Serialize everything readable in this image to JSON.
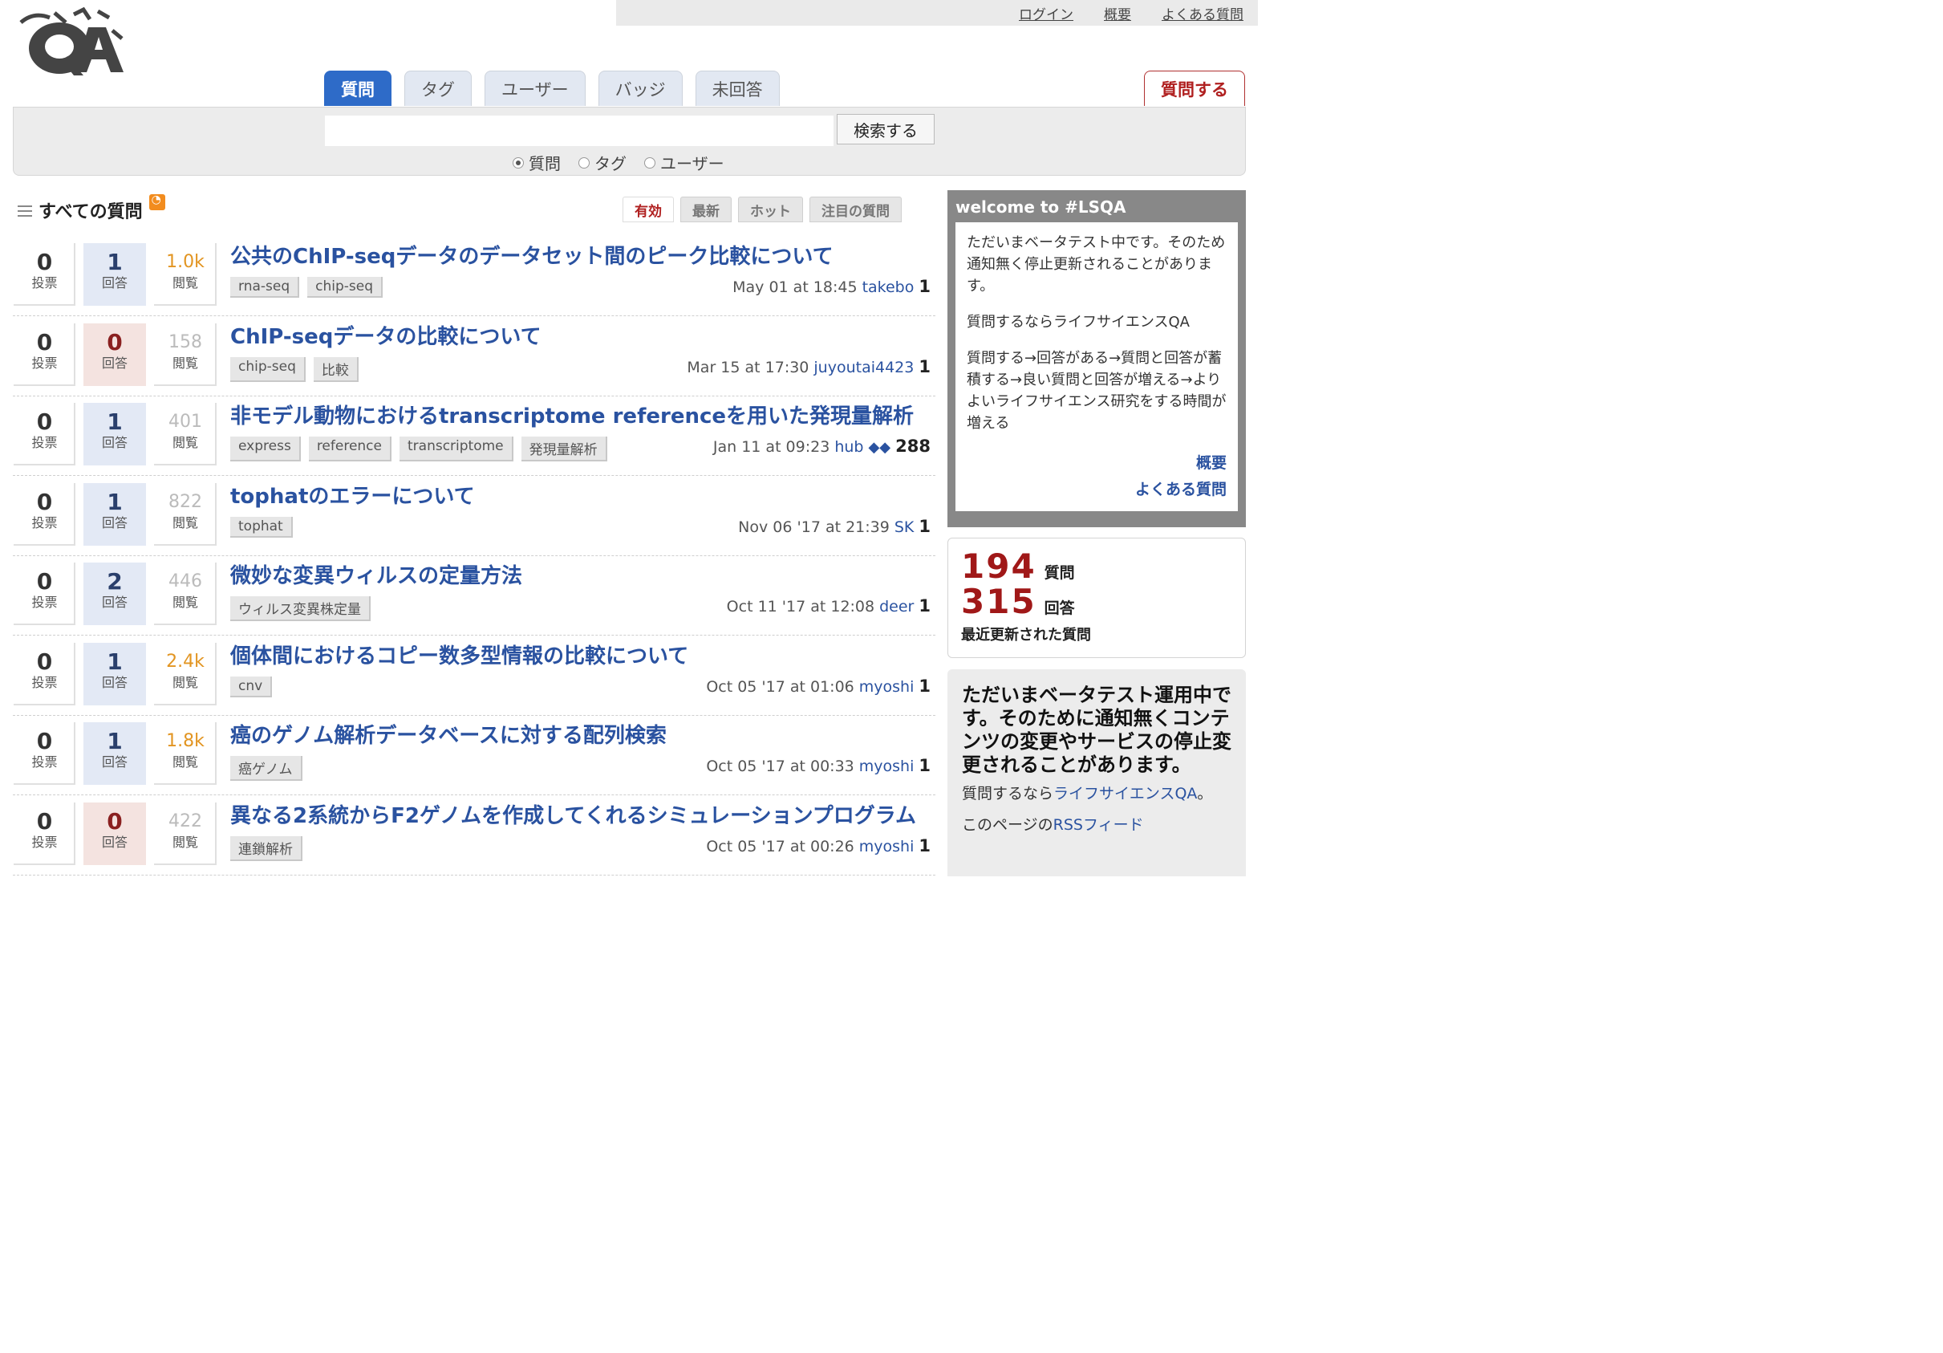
{
  "top_links": [
    "ログイン",
    "概要",
    "よくある質問"
  ],
  "logo_text": "ライフサイエンスQA",
  "tabs": [
    "質問",
    "タグ",
    "ユーザー",
    "バッジ",
    "未回答"
  ],
  "ask_button": "質問する",
  "search": {
    "button": "検索する",
    "value": "",
    "options": [
      "質問",
      "タグ",
      "ユーザー"
    ],
    "selected": "質問"
  },
  "list": {
    "title": "すべての質問",
    "sorts": [
      "有効",
      "最新",
      "ホット",
      "注目の質問"
    ],
    "vote_label": "投票",
    "answer_label": "回答",
    "view_label": "閲覧"
  },
  "questions": [
    {
      "votes": "0",
      "answers": "1",
      "views": "1.0k",
      "title": "公共のChIP-seqデータのデータセット間のピーク比較について",
      "tags": [
        "rna-seq",
        "chip-seq"
      ],
      "time": "May 01 at 18:45",
      "user": "takebo",
      "badges": "",
      "rep": "1"
    },
    {
      "votes": "0",
      "answers": "0",
      "views": "158",
      "title": "ChIP-seqデータの比較について",
      "tags": [
        "chip-seq",
        "比較"
      ],
      "time": "Mar 15 at 17:30",
      "user": "juyoutai4423",
      "badges": "",
      "rep": "1"
    },
    {
      "votes": "0",
      "answers": "1",
      "views": "401",
      "title": "非モデル動物におけるtranscriptome referenceを用いた発現量解析",
      "tags": [
        "express",
        "reference",
        "transcriptome",
        "発現量解析"
      ],
      "time": "Jan 11 at 09:23",
      "user": "hub",
      "badges": "◆◆",
      "rep": "288"
    },
    {
      "votes": "0",
      "answers": "1",
      "views": "822",
      "title": "tophatのエラーについて",
      "tags": [
        "tophat"
      ],
      "time": "Nov 06 '17 at 21:39",
      "user": "SK",
      "badges": "",
      "rep": "1"
    },
    {
      "votes": "0",
      "answers": "2",
      "views": "446",
      "title": "微妙な変異ウィルスの定量方法",
      "tags": [
        "ウィルス変異株定量"
      ],
      "time": "Oct 11 '17 at 12:08",
      "user": "deer",
      "badges": "",
      "rep": "1"
    },
    {
      "votes": "0",
      "answers": "1",
      "views": "2.4k",
      "title": "個体間におけるコピー数多型情報の比較について",
      "tags": [
        "cnv"
      ],
      "time": "Oct 05 '17 at 01:06",
      "user": "myoshi",
      "badges": "",
      "rep": "1"
    },
    {
      "votes": "0",
      "answers": "1",
      "views": "1.8k",
      "title": "癌のゲノム解析データベースに対する配列検索",
      "tags": [
        "癌ゲノム"
      ],
      "time": "Oct 05 '17 at 00:33",
      "user": "myoshi",
      "badges": "",
      "rep": "1"
    },
    {
      "votes": "0",
      "answers": "0",
      "views": "422",
      "title": "異なる2系統からF2ゲノムを作成してくれるシミュレーションプログラム",
      "tags": [
        "連鎖解析"
      ],
      "time": "Oct 05 '17 at 00:26",
      "user": "myoshi",
      "badges": "",
      "rep": "1"
    }
  ],
  "sidebar": {
    "welcome_title": "welcome to #LSQA",
    "welcome_paragraphs": [
      "ただいまベータテスト中です。そのため通知無く停止更新されることがあります。",
      "質問するならライフサイエンスQA",
      "質問する→回答がある→質問と回答が蓄積する→良い質問と回答が増える→よりよいライフサイエンス研究をする時間が増える"
    ],
    "welcome_links": [
      "概要",
      "よくある質問"
    ],
    "stats": {
      "questions": "194",
      "questions_label": "質問",
      "answers": "315",
      "answers_label": "回答",
      "recent": "最近更新された質問"
    },
    "notice_heading": "ただいまベータテスト運用中です。そのために通知無くコンテンツの変更やサービスの停止変更されることがあります。",
    "notice_line1_prefix": "質問するなら",
    "notice_line1_link": "ライフサイエンスQA",
    "notice_line1_suffix": "。",
    "notice_line2_prefix": "このページの",
    "notice_line2_link": "RSSフィード"
  }
}
